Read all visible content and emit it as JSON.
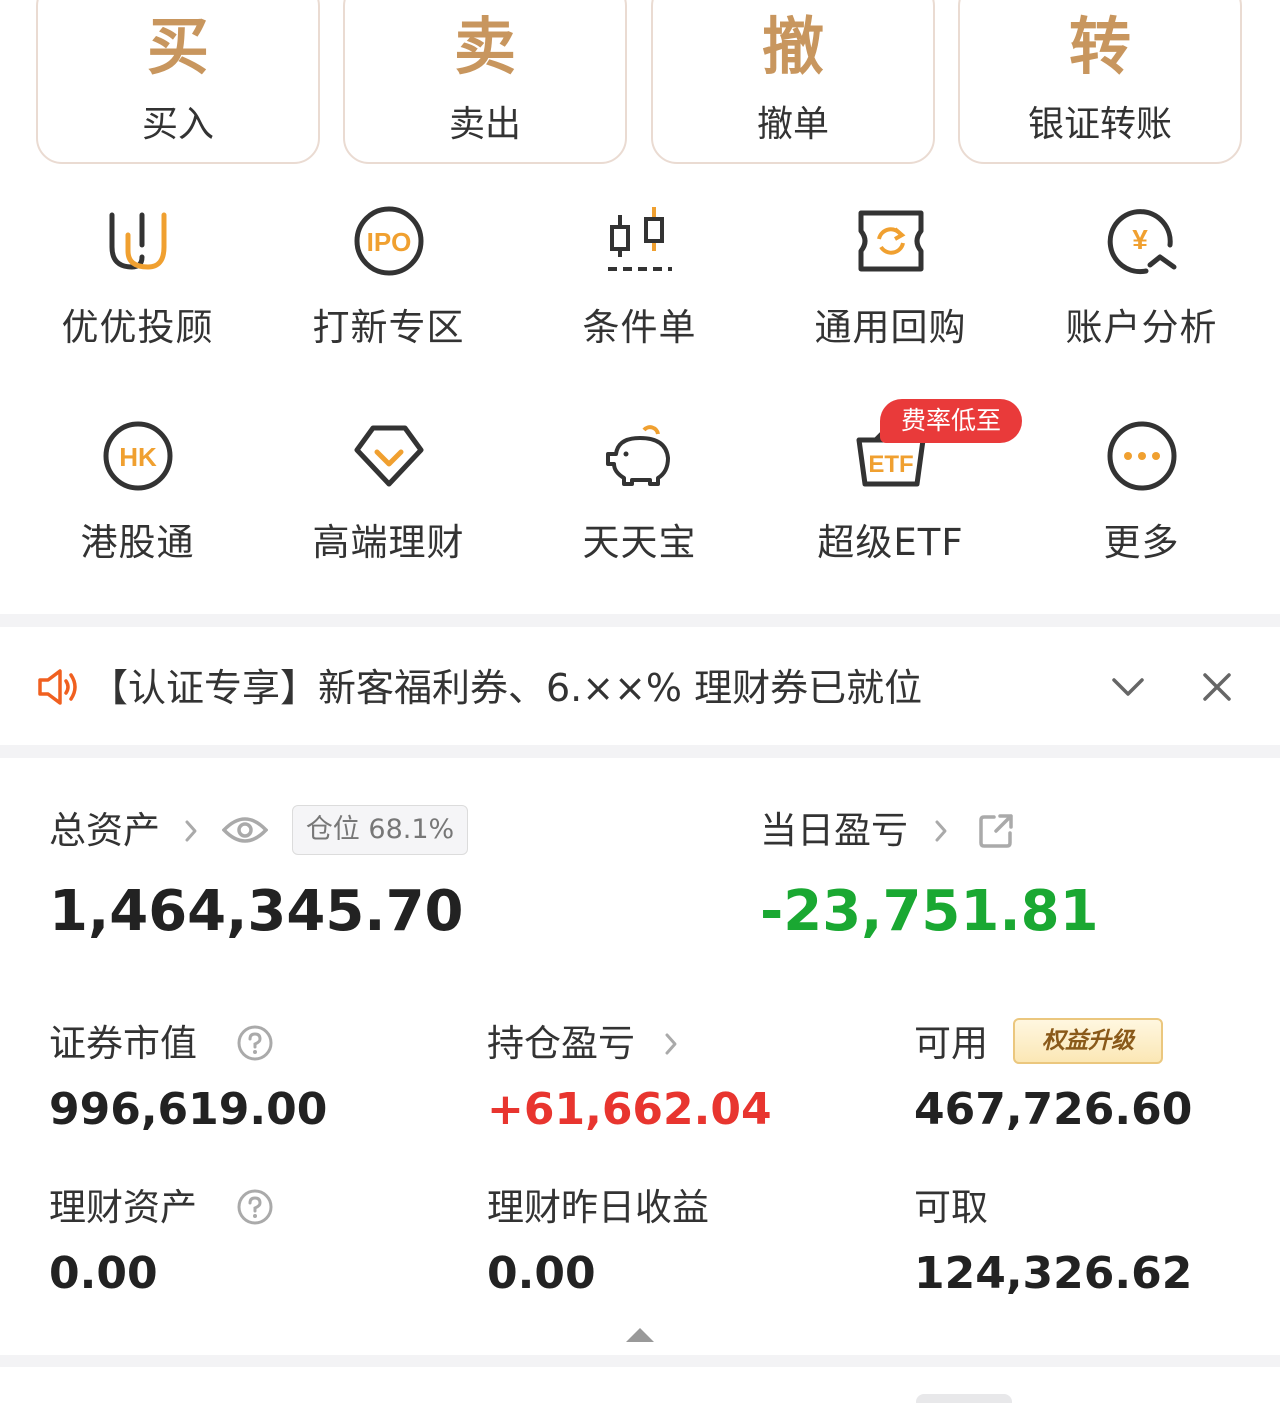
{
  "trade_buttons": [
    {
      "big": "买",
      "label": "买入"
    },
    {
      "big": "卖",
      "label": "卖出"
    },
    {
      "big": "撤",
      "label": "撤单"
    },
    {
      "big": "转",
      "label": "银证转账"
    }
  ],
  "features_row1": [
    {
      "label": "优优投顾",
      "icon": "youyou-advisor-icon"
    },
    {
      "label": "打新专区",
      "icon": "ipo-icon"
    },
    {
      "label": "条件单",
      "icon": "condition-order-icon"
    },
    {
      "label": "通用回购",
      "icon": "repo-icon"
    },
    {
      "label": "账户分析",
      "icon": "account-analysis-icon"
    }
  ],
  "features_row2": [
    {
      "label": "港股通",
      "icon": "hk-connect-icon"
    },
    {
      "label": "高端理财",
      "icon": "premium-finance-icon"
    },
    {
      "label": "天天宝",
      "icon": "piggy-bank-icon"
    },
    {
      "label": "超级ETF",
      "icon": "etf-icon"
    },
    {
      "label": "更多",
      "icon": "more-icon"
    }
  ],
  "etf_badge": "费率低至",
  "notice": {
    "text": "【认证专享】新客福利券、6.××% 理财券已就位"
  },
  "assets": {
    "total_label": "总资产",
    "position_pill": "仓位 68.1%",
    "total_value": "1,464,345.70",
    "daily_pl_label": "当日盈亏",
    "daily_pl_value": "-23,751.81",
    "securities_label": "证券市值",
    "securities_value": "996,619.00",
    "holding_pl_label": "持仓盈亏",
    "holding_pl_value": "+61,662.04",
    "available_label": "可用",
    "upgrade_badge": "权益升级",
    "available_value": "467,726.60",
    "finance_label": "理财资产",
    "finance_value": "0.00",
    "finance_yesterday_label": "理财昨日收益",
    "finance_yesterday_value": "0.00",
    "withdrawable_label": "可取",
    "withdrawable_value": "124,326.62"
  },
  "colors": {
    "gold": "#c8965e",
    "orange": "#f0a030",
    "loss_green": "#1aa832",
    "profit_red": "#e8352f"
  }
}
